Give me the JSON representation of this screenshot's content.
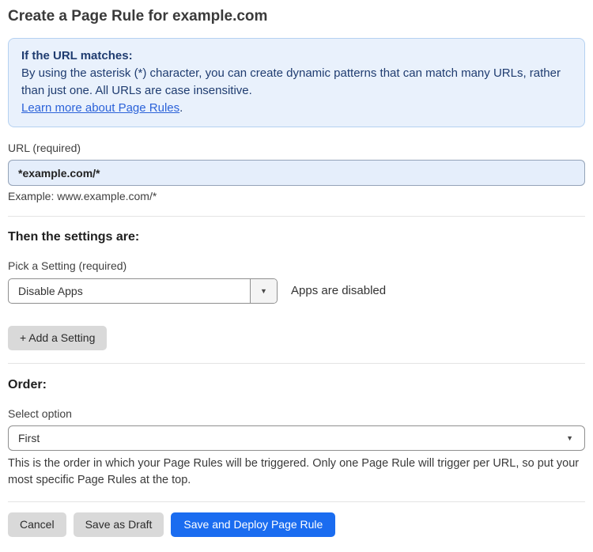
{
  "page": {
    "title": "Create a Page Rule for example.com"
  },
  "colors": {
    "accent_blue": "#1a6cf0",
    "info_box_bg": "#e9f1fc",
    "info_box_border": "#b5d1f1",
    "info_text": "#1f3c70",
    "link_blue": "#2b62d9",
    "url_input_bg": "#e5eefb",
    "gray_button_bg": "#d9d9d9"
  },
  "info_box": {
    "heading": "If the URL matches:",
    "body": "By using the asterisk (*) character, you can create dynamic patterns that can match many URLs, rather than just one. All URLs are case insensitive.",
    "link_text": "Learn more about Page Rules",
    "link_suffix": "."
  },
  "url_field": {
    "label": "URL (required)",
    "value": "*example.com/*",
    "helper": "Example: www.example.com/*"
  },
  "settings": {
    "heading": "Then the settings are:",
    "picker_label": "Pick a Setting (required)",
    "selected_setting": "Disable Apps",
    "status_text": "Apps are disabled",
    "add_setting_label": "+ Add a Setting"
  },
  "order": {
    "heading": "Order:",
    "label": "Select option",
    "selected_option": "First",
    "helper": "This is the order in which your Page Rules will be triggered. Only one Page Rule will trigger per URL, so put your most specific Page Rules at the top."
  },
  "footer": {
    "cancel_label": "Cancel",
    "save_draft_label": "Save as Draft",
    "save_deploy_label": "Save and Deploy Page Rule"
  }
}
